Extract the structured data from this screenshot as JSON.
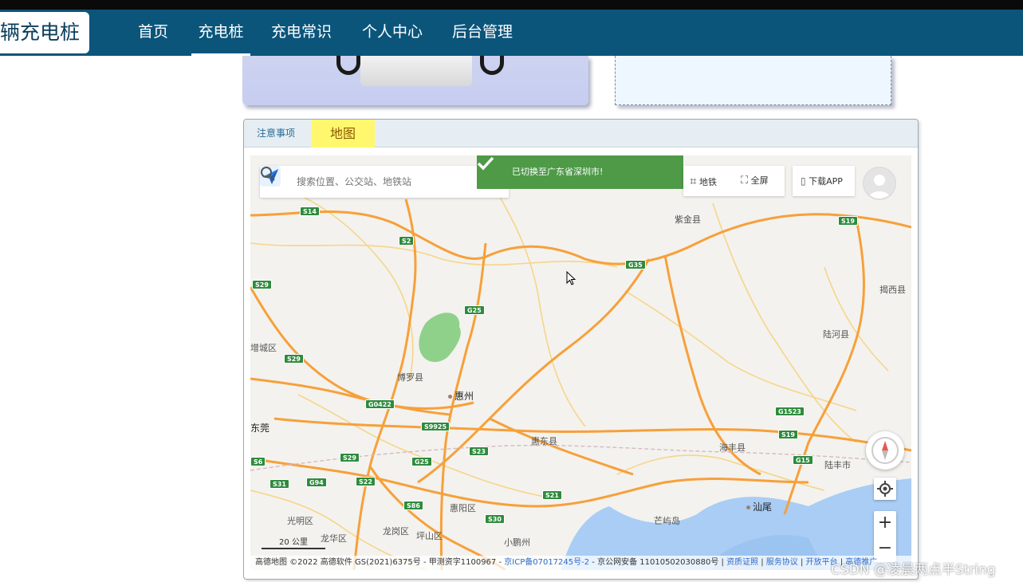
{
  "nav": {
    "logo": "辆充电桩",
    "items": [
      "首页",
      "充电桩",
      "充电常识",
      "个人中心",
      "后台管理"
    ],
    "active_index": 1
  },
  "tabs": [
    {
      "label": "注意事项"
    },
    {
      "label": "地图"
    }
  ],
  "map": {
    "search_placeholder": "搜索位置、公交站、地铁站",
    "toast": "已切换至广东省深圳市!",
    "subway_label": "地铁",
    "fullscreen_label": "全屏",
    "download_label": "下载APP",
    "scale_label": "20 公里",
    "copyright_prefix": "高德地图 ©2022 高德软件 GS(2021)6375号 - 甲测资字1100967 - ",
    "icp_link": "京ICP备07017245号-2",
    "police": " - 京公网安备 11010502030880号 | ",
    "link_license": "资质证照",
    "link_service": "服务协议",
    "link_open": "开放平台",
    "link_tail": "高德推广",
    "cities": [
      {
        "name": "惠州",
        "big": true
      },
      {
        "name": "汕尾",
        "big": true
      },
      {
        "name": "紫金县"
      },
      {
        "name": "揭西县"
      },
      {
        "name": "陆河县"
      },
      {
        "name": "博罗县"
      },
      {
        "name": "东莞"
      },
      {
        "name": "惠东县"
      },
      {
        "name": "海丰县"
      },
      {
        "name": "陆丰市"
      },
      {
        "name": "惠阳区"
      },
      {
        "name": "光明区"
      },
      {
        "name": "龙华区"
      },
      {
        "name": "龙岗区"
      },
      {
        "name": "坪山区"
      },
      {
        "name": "小鹏州"
      },
      {
        "name": "芒屿岛"
      },
      {
        "name": "增城区"
      }
    ],
    "roads": [
      "S14",
      "S2",
      "S19",
      "G35",
      "S29",
      "G25",
      "S29",
      "G0422",
      "S9925",
      "G1523",
      "S19",
      "S6",
      "S29",
      "G25",
      "S23",
      "G15",
      "S31",
      "G94",
      "S22",
      "S86",
      "S30",
      "S21"
    ]
  },
  "watermark": "CSDN @凌晨两点半String"
}
